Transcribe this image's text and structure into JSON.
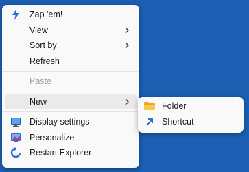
{
  "context_menu": {
    "items": [
      {
        "label": "Zap 'em!",
        "icon": "lightning-icon"
      },
      {
        "label": "View",
        "has_submenu": true
      },
      {
        "label": "Sort by",
        "has_submenu": true
      },
      {
        "label": "Refresh"
      },
      {
        "label": "Paste",
        "disabled": true
      },
      {
        "label": "New",
        "has_submenu": true,
        "active": true
      },
      {
        "label": "Display settings",
        "icon": "display-icon"
      },
      {
        "label": "Personalize",
        "icon": "personalize-icon"
      },
      {
        "label": "Restart Explorer",
        "icon": "restart-icon"
      }
    ]
  },
  "new_submenu": {
    "items": [
      {
        "label": "Folder",
        "icon": "folder-icon"
      },
      {
        "label": "Shortcut",
        "icon": "shortcut-arrow-icon"
      }
    ]
  },
  "colors": {
    "desktop_background": "#1c5fb3",
    "menu_background": "#f9f9f9",
    "active_item": "#eaeaea",
    "disabled_text": "#a0a0a0"
  }
}
